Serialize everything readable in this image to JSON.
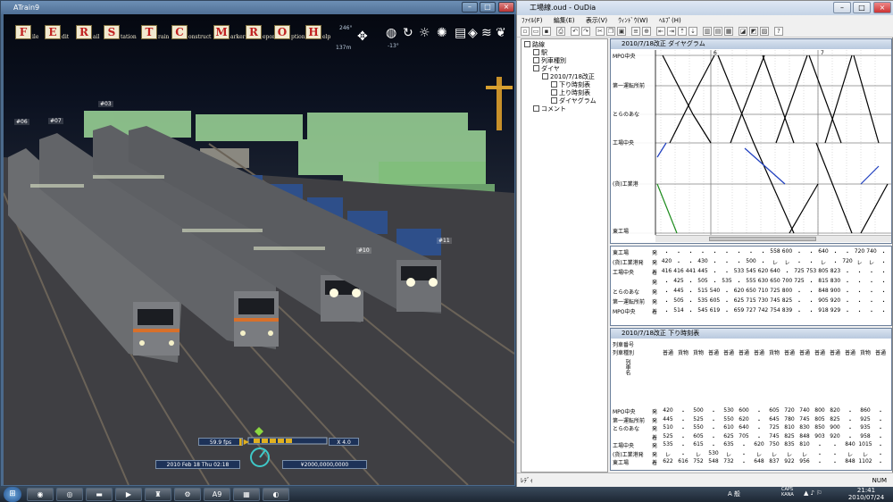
{
  "game": {
    "window_title": "ATrain9",
    "menu": [
      {
        "letter": "F",
        "rest": "ile"
      },
      {
        "letter": "E",
        "rest": "dit"
      },
      {
        "letter": "R",
        "rest": "ail"
      },
      {
        "letter": "S",
        "rest": "tation"
      },
      {
        "letter": "T",
        "rest": "rain"
      },
      {
        "letter": "C",
        "rest": "onstruct"
      },
      {
        "letter": "M",
        "rest": "arker"
      },
      {
        "letter": "R",
        "rest": "eport"
      },
      {
        "letter": "O",
        "rest": "ption"
      },
      {
        "letter": "H",
        "rest": "elp"
      }
    ],
    "altitude_top": "246°",
    "altitude_bottom": "137m",
    "tilt": "-13°",
    "train_tags": [
      "#06",
      "#07",
      "#03",
      "#10",
      "#11"
    ],
    "fps": "59.9 fps",
    "speed": "X 4.0",
    "date": "2010 Feb 18 Thu  02:18",
    "money": "¥2000,0000,0000"
  },
  "oudia": {
    "window_title": "工場線.oud - OuDia",
    "menu": [
      "ﾌｧｲﾙ(F)",
      "編集(E)",
      "表示(V)",
      "ｳｨﾝﾄﾞｳ(W)",
      "ﾍﾙﾌﾟ(H)"
    ],
    "tree": {
      "root": "路線",
      "station": "駅",
      "train_type": "列車種別",
      "dia": "ダイヤ",
      "dia_item": "2010/7/18改正",
      "down": "下り時刻表",
      "up": "上り時刻表",
      "diagram": "ダイヤグラム",
      "comment": "コメント"
    },
    "diagram_title": "2010/7/18改正 ダイヤグラム",
    "diagram_stations": [
      "MPO中央",
      "第一運転所前",
      "とらのあな",
      "工場中央",
      "(貨)工業港",
      "東工場"
    ],
    "diagram_hours": [
      "6",
      "7"
    ],
    "upper_table": {
      "rows": [
        {
          "name": "東工場",
          "suffix": "発",
          "cells": [
            "・",
            "・",
            "・",
            "・",
            "・",
            "・",
            "・",
            "・",
            "・",
            "558",
            "600",
            "・",
            "・",
            "640",
            "・",
            "・",
            "720",
            "740",
            "・"
          ]
        },
        {
          "name": "(貨)工業港発",
          "suffix": "発",
          "cells": [
            "420",
            "・",
            "・",
            "430",
            "・",
            "・",
            "・",
            "500",
            "・",
            "レ",
            "レ",
            "・",
            "・",
            "レ",
            "・",
            "720",
            "レ",
            "レ",
            "・"
          ]
        },
        {
          "name": "工場中央",
          "suffix": "着",
          "cells": [
            "416",
            "416",
            "441",
            "445",
            "・",
            "・",
            "533",
            "545",
            "620",
            "640",
            "・",
            "725",
            "753",
            "805",
            "823",
            "・",
            "・",
            "・",
            "・"
          ]
        },
        {
          "name": "",
          "suffix": "発",
          "cells": [
            "・",
            "425",
            "・",
            "505",
            "・",
            "535",
            "・",
            "555",
            "630",
            "650",
            "700",
            "725",
            "・",
            "815",
            "830",
            "・",
            "・",
            "・",
            "・"
          ]
        },
        {
          "name": "とらのあな",
          "suffix": "発",
          "cells": [
            "・",
            "445",
            "・",
            "515",
            "540",
            "・",
            "620",
            "650",
            "710",
            "725",
            "800",
            "・",
            "・",
            "848",
            "900",
            "・",
            "・",
            "・",
            "・"
          ]
        },
        {
          "name": "第一運転所前",
          "suffix": "発",
          "cells": [
            "・",
            "505",
            "・",
            "535",
            "605",
            "・",
            "625",
            "715",
            "730",
            "745",
            "825",
            "・",
            "・",
            "905",
            "920",
            "・",
            "・",
            "・",
            "・"
          ]
        },
        {
          "name": "MPO中央",
          "suffix": "着",
          "cells": [
            "・",
            "514",
            "・",
            "545",
            "619",
            "・",
            "659",
            "727",
            "742",
            "754",
            "839",
            "・",
            "・",
            "918",
            "929",
            "・",
            "・",
            "・",
            "・"
          ]
        }
      ]
    },
    "timetable_title": "2010/7/18改正 下り時刻表",
    "timetable_header_1": "列車番号",
    "timetable_header_2": "列車種別",
    "timetable_header_3": "列車名",
    "timetable_types": [
      "普通",
      "貨物",
      "貨物",
      "普通",
      "普通",
      "普通",
      "普通",
      "貨物",
      "普通",
      "普通",
      "普通",
      "普通",
      "普通",
      "貨物",
      "普通"
    ],
    "timetable_rows": [
      {
        "name": "MPO中央",
        "suffix": "発",
        "cells": [
          "420",
          "・",
          "500",
          "・",
          "530",
          "600",
          "・",
          "605",
          "720",
          "740",
          "800",
          "820",
          "・",
          "860",
          "・"
        ]
      },
      {
        "name": "第一運転所前",
        "suffix": "発",
        "cells": [
          "445",
          "・",
          "525",
          "・",
          "550",
          "620",
          "・",
          "645",
          "780",
          "745",
          "805",
          "825",
          "・",
          "925",
          "・"
        ]
      },
      {
        "name": "とらのあな",
        "suffix": "発",
        "cells": [
          "510",
          "・",
          "550",
          "・",
          "610",
          "640",
          "・",
          "725",
          "810",
          "830",
          "850",
          "900",
          "・",
          "935",
          "・"
        ]
      },
      {
        "name": "",
        "suffix": "着",
        "cells": [
          "525",
          "・",
          "605",
          "・",
          "625",
          "705",
          "・",
          "745",
          "825",
          "848",
          "903",
          "920",
          "・",
          "958",
          "・"
        ]
      },
      {
        "name": "工場中央",
        "suffix": "発",
        "cells": [
          "535",
          "・",
          "615",
          "・",
          "635",
          "・",
          "620",
          "750",
          "835",
          "810",
          "・",
          "・",
          "840",
          "1015",
          "・"
        ]
      },
      {
        "name": "(貨)工業港発",
        "suffix": "発",
        "cells": [
          "レ",
          "・",
          "レ",
          "530",
          "レ",
          "・",
          "レ",
          "レ",
          "レ",
          "レ",
          "・",
          "・",
          "レ",
          "レ",
          "・"
        ]
      },
      {
        "name": "東工場",
        "suffix": "着",
        "cells": [
          "622",
          "616",
          "752",
          "548",
          "732",
          "・",
          "648",
          "837",
          "922",
          "956",
          "・",
          "・",
          "848",
          "1102",
          "・"
        ]
      }
    ],
    "status_left": "ﾚﾃﾞｨ",
    "status_right": "NUM"
  },
  "taskbar": {
    "clock_time": "21:41",
    "clock_date": "2010/07/24",
    "ime": "A 般",
    "caps": "CAPS KANA"
  },
  "colors": {
    "diagram_line": "#000000",
    "diagram_freight": "#1f3fbf",
    "diagram_green": "#1a8a1a",
    "menu_letter": "#c02020",
    "container_green": "#9fd99a"
  }
}
